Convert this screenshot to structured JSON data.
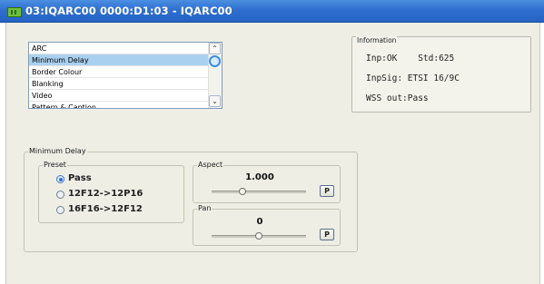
{
  "window": {
    "title": "03:IQARC00  0000:D1:03  - IQARC00"
  },
  "list": {
    "items": [
      "ARC",
      "Minimum Delay",
      "Border Colour",
      "Blanking",
      "Video",
      "Pattern & Caption"
    ],
    "selected": "Minimum Delay"
  },
  "information": {
    "label": "Information",
    "line1": "Inp:OK    Std:625",
    "line2": "InpSig: ETSI 16/9C",
    "line3": "WSS out:Pass"
  },
  "minimum_delay": {
    "label": "Minimum Delay",
    "preset": {
      "label": "Preset",
      "options": [
        "Pass",
        "12F12->12P16",
        "16F16->12F12"
      ],
      "selected": "Pass"
    },
    "aspect": {
      "label": "Aspect",
      "value": "1.000",
      "slider_fraction": 0.33,
      "button": "P"
    },
    "pan": {
      "label": "Pan",
      "value": "0",
      "slider_fraction": 0.5,
      "button": "P"
    }
  }
}
